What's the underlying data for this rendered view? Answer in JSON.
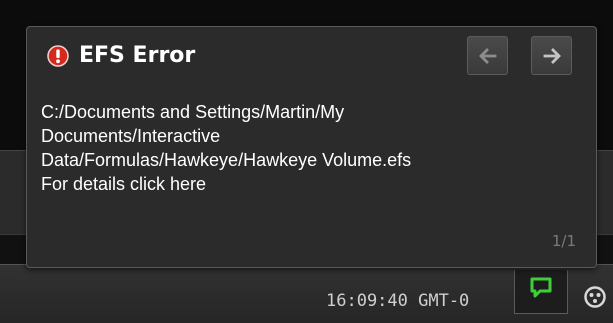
{
  "notification": {
    "title": "EFS Error",
    "message_lines": [
      "C:/Documents and Settings/Martin/My",
      "Documents/Interactive",
      "Data/Formulas/Hawkeye/Hawkeye Volume.efs"
    ],
    "details_link": "For details click here",
    "counter": "1/1",
    "icons": {
      "status": "error-icon",
      "prev": "arrow-left-icon",
      "next": "arrow-right-icon"
    },
    "colors": {
      "error": "#d42a1e",
      "background": "#2b2b2b",
      "text": "#ffffff"
    }
  },
  "status_bar": {
    "time": "16:09:40 GMT-0",
    "icons": {
      "chat": "chat-bubble-icon",
      "connection": "connection-status-icon"
    },
    "colors": {
      "chat": "#3fcf3a"
    }
  }
}
